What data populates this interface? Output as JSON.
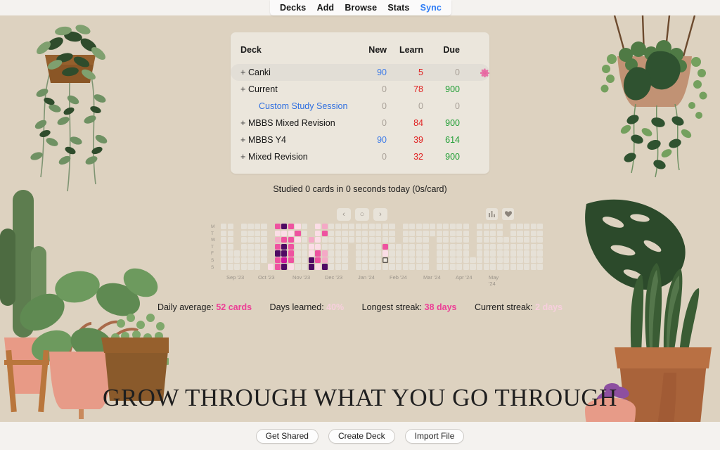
{
  "menu": {
    "items": [
      {
        "label": "Decks",
        "active": false
      },
      {
        "label": "Add",
        "active": false
      },
      {
        "label": "Browse",
        "active": false
      },
      {
        "label": "Stats",
        "active": false
      },
      {
        "label": "Sync",
        "active": true
      }
    ]
  },
  "deck_table": {
    "headers": {
      "deck": "Deck",
      "new": "New",
      "learn": "Learn",
      "due": "Due"
    },
    "rows": [
      {
        "name": "Canki",
        "expander": "+",
        "new": "90",
        "learn": "5",
        "due": "0",
        "new_zero": false,
        "learn_zero": false,
        "due_zero": true,
        "hovered": true,
        "is_link": false,
        "gear": "gear-icon"
      },
      {
        "name": "Current",
        "expander": "+",
        "new": "0",
        "learn": "78",
        "due": "900",
        "new_zero": true,
        "learn_zero": false,
        "due_zero": false,
        "hovered": false,
        "is_link": false,
        "gear": ""
      },
      {
        "name": "Custom Study Session",
        "expander": "",
        "new": "0",
        "learn": "0",
        "due": "0",
        "new_zero": true,
        "learn_zero": true,
        "due_zero": true,
        "hovered": false,
        "is_link": true,
        "gear": ""
      },
      {
        "name": "MBBS Mixed Revision",
        "expander": "+",
        "new": "0",
        "learn": "84",
        "due": "900",
        "new_zero": true,
        "learn_zero": false,
        "due_zero": false,
        "hovered": false,
        "is_link": false,
        "gear": ""
      },
      {
        "name": "MBBS Y4",
        "expander": "+",
        "new": "90",
        "learn": "39",
        "due": "614",
        "new_zero": false,
        "learn_zero": false,
        "due_zero": false,
        "hovered": false,
        "is_link": false,
        "gear": ""
      },
      {
        "name": "Mixed Revision",
        "expander": "+",
        "new": "0",
        "learn": "32",
        "due": "900",
        "new_zero": true,
        "learn_zero": false,
        "due_zero": false,
        "hovered": false,
        "is_link": false,
        "gear": ""
      }
    ]
  },
  "studied_text": "Studied 0 cards in 0 seconds today (0s/card)",
  "heatmap_nav": {
    "prev": "‹",
    "reset": "○",
    "next": "›",
    "chart_button": "bar-chart-icon",
    "heart_button": "heart-icon"
  },
  "heatmap": {
    "day_labels": [
      "M",
      "T",
      "W",
      "T",
      "F",
      "S",
      "S"
    ],
    "month_labels": [
      "Sep '23",
      "Oct '23",
      "Nov '23",
      "Dec '23",
      "Jan '24",
      "Feb '24",
      "Mar '24",
      "Apr '24",
      "May '24"
    ],
    "colors": {
      "l0": "#e6e1d7",
      "l1": "#fbdde6",
      "l2": "#f4a9c6",
      "l3": "#ee52a0",
      "l4": "#c9159a",
      "l5": "#4e0a63",
      "today_outline": "#5d5750"
    },
    "month_label_x": [
      8,
      53,
      102,
      148,
      195,
      240,
      288,
      334,
      381
    ],
    "weeks": [
      {
        "levels": [
          0,
          0,
          0,
          0,
          0,
          0,
          0
        ]
      },
      {
        "levels": [
          0,
          0,
          0,
          0,
          0,
          0,
          0
        ]
      },
      {
        "levels": [
          -1,
          -1,
          -1,
          -1,
          0,
          0,
          0
        ]
      },
      {
        "levels": [
          0,
          0,
          0,
          0,
          0,
          0,
          0
        ]
      },
      {
        "levels": [
          0,
          0,
          0,
          0,
          0,
          0,
          0
        ]
      },
      {
        "levels": [
          0,
          0,
          0,
          0,
          0,
          0,
          0
        ]
      },
      {
        "levels": [
          0,
          0,
          0,
          0,
          0,
          0,
          -1
        ]
      },
      {
        "levels": [
          -1,
          -1,
          -1,
          -1,
          -1,
          -1,
          1
        ]
      },
      {
        "levels": [
          3,
          1,
          2,
          3,
          5,
          3,
          3
        ]
      },
      {
        "levels": [
          5,
          1,
          3,
          5,
          5,
          4,
          5
        ]
      },
      {
        "levels": [
          3,
          1,
          3,
          3,
          3,
          3,
          1
        ]
      },
      {
        "levels": [
          1,
          3,
          1,
          0,
          0,
          0,
          0
        ]
      },
      {
        "levels": [
          0,
          0,
          0,
          0,
          0,
          0,
          0
        ]
      },
      {
        "levels": [
          -1,
          -1,
          2,
          1,
          1,
          5,
          5
        ]
      },
      {
        "levels": [
          1,
          1,
          1,
          1,
          3,
          3,
          1
        ]
      },
      {
        "levels": [
          2,
          3,
          0,
          0,
          2,
          2,
          5
        ]
      },
      {
        "levels": [
          0,
          0,
          0,
          0,
          0,
          0,
          0
        ]
      },
      {
        "levels": [
          0,
          0,
          0,
          0,
          0,
          0,
          0
        ]
      },
      {
        "levels": [
          0,
          0,
          0,
          0,
          0,
          0,
          0
        ]
      },
      {
        "levels": [
          0,
          0,
          0,
          -1,
          -1,
          -1,
          -1
        ]
      },
      {
        "levels": [
          0,
          0,
          0,
          0,
          0,
          0,
          0
        ]
      },
      {
        "levels": [
          0,
          0,
          0,
          0,
          0,
          0,
          0
        ]
      },
      {
        "levels": [
          0,
          0,
          0,
          0,
          0,
          0,
          0
        ]
      },
      {
        "levels": [
          0,
          0,
          0,
          0,
          0,
          0,
          0
        ]
      },
      {
        "levels": [
          0,
          0,
          0,
          3,
          1,
          99,
          0
        ]
      },
      {
        "levels": [
          0,
          0,
          0,
          0,
          0,
          0,
          0
        ]
      },
      {
        "levels": [
          -1,
          -1,
          -1,
          0,
          0,
          0,
          0
        ]
      },
      {
        "levels": [
          0,
          0,
          0,
          0,
          0,
          0,
          0
        ]
      },
      {
        "levels": [
          0,
          0,
          0,
          0,
          0,
          0,
          0
        ]
      },
      {
        "levels": [
          0,
          0,
          0,
          0,
          0,
          0,
          0
        ]
      },
      {
        "levels": [
          0,
          0,
          0,
          0,
          0,
          0,
          0
        ]
      },
      {
        "levels": [
          0,
          0,
          -1,
          -1,
          -1,
          -1,
          -1
        ]
      },
      {
        "levels": [
          0,
          0,
          0,
          0,
          0,
          0,
          0
        ]
      },
      {
        "levels": [
          0,
          0,
          0,
          0,
          0,
          0,
          0
        ]
      },
      {
        "levels": [
          0,
          0,
          0,
          0,
          0,
          0,
          0
        ]
      },
      {
        "levels": [
          0,
          0,
          0,
          0,
          0,
          0,
          0
        ]
      },
      {
        "levels": [
          0,
          0,
          0,
          0,
          0,
          0,
          0
        ]
      },
      {
        "levels": [
          -1,
          -1,
          -1,
          -1,
          -1,
          0,
          0
        ]
      },
      {
        "levels": [
          0,
          0,
          0,
          0,
          0,
          0,
          0
        ]
      },
      {
        "levels": [
          0,
          0,
          0,
          0,
          0,
          0,
          0
        ]
      },
      {
        "levels": [
          0,
          0,
          0,
          0,
          0,
          0,
          0
        ]
      },
      {
        "levels": [
          0,
          0,
          0,
          0,
          0,
          0,
          0
        ]
      },
      {
        "levels": [
          -1,
          -1,
          0,
          0,
          0,
          0,
          0
        ]
      },
      {
        "levels": [
          0,
          0,
          0,
          0,
          0,
          0,
          0
        ]
      },
      {
        "levels": [
          0,
          0,
          0,
          0,
          0,
          0,
          0
        ]
      },
      {
        "levels": [
          0,
          0,
          0,
          0,
          0,
          0,
          0
        ]
      },
      {
        "levels": [
          0,
          0,
          0,
          0,
          0,
          0,
          0
        ]
      },
      {
        "levels": [
          0,
          0,
          0,
          0,
          0,
          0,
          0
        ]
      }
    ]
  },
  "stats": {
    "daily_average_label": "Daily average:",
    "daily_average_value": "52 cards",
    "days_learned_label": "Days learned:",
    "days_learned_value": "40%",
    "longest_streak_label": "Longest streak:",
    "longest_streak_value": "38 days",
    "current_streak_label": "Current streak:",
    "current_streak_value": "2 days"
  },
  "quote": "GROW THROUGH WHAT YOU GO THROUGH",
  "bottom_buttons": [
    {
      "label": "Get Shared"
    },
    {
      "label": "Create Deck"
    },
    {
      "label": "Import File"
    }
  ],
  "theme": {
    "background": "#ddd2c0",
    "panel": "#ebe6dc",
    "chrome": "#f4f2ef",
    "accent_pink": "#ec3f96",
    "link_blue": "#2f6fe0",
    "new_blue": "#3b7ae8",
    "learn_red": "#e02020",
    "due_green": "#1f9d33"
  }
}
